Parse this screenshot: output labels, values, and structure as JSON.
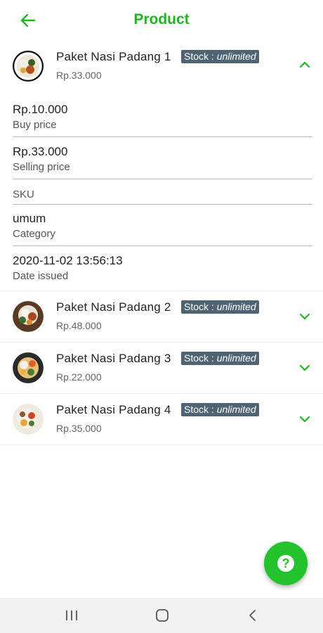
{
  "header": {
    "title": "Product"
  },
  "products": [
    {
      "name": "Paket Nasi Padang 1",
      "stock_label": "Stock :",
      "stock_value": "unlimited",
      "price": "Rp.33.000",
      "expanded": true
    },
    {
      "name": "Paket Nasi Padang 2",
      "stock_label": "Stock :",
      "stock_value": "unlimited",
      "price": "Rp.48.000",
      "expanded": false
    },
    {
      "name": "Paket Nasi Padang 3",
      "stock_label": "Stock :",
      "stock_value": "unlimited",
      "price": "Rp.22.000",
      "expanded": false
    },
    {
      "name": "Paket Nasi Padang 4",
      "stock_label": "Stock :",
      "stock_value": "unlimited",
      "price": "Rp.35.000",
      "expanded": false
    }
  ],
  "details": {
    "buy_price": {
      "value": "Rp.10.000",
      "label": "Buy price"
    },
    "selling_price": {
      "value": "Rp.33.000",
      "label": "Selling price"
    },
    "sku": {
      "value": "",
      "label": "SKU"
    },
    "category": {
      "value": "umum",
      "label": "Category"
    },
    "date_issued": {
      "value": "2020-11-02 13:56:13",
      "label": "Date issued"
    }
  },
  "fab": {
    "icon": "help-icon",
    "glyph": "?"
  },
  "colors": {
    "accent": "#22b422",
    "badge": "#4f6472",
    "fab": "#22c32c"
  },
  "icons": {
    "back": "arrow-left-icon",
    "expand": "chevron-down-icon",
    "collapse": "chevron-up-icon"
  }
}
